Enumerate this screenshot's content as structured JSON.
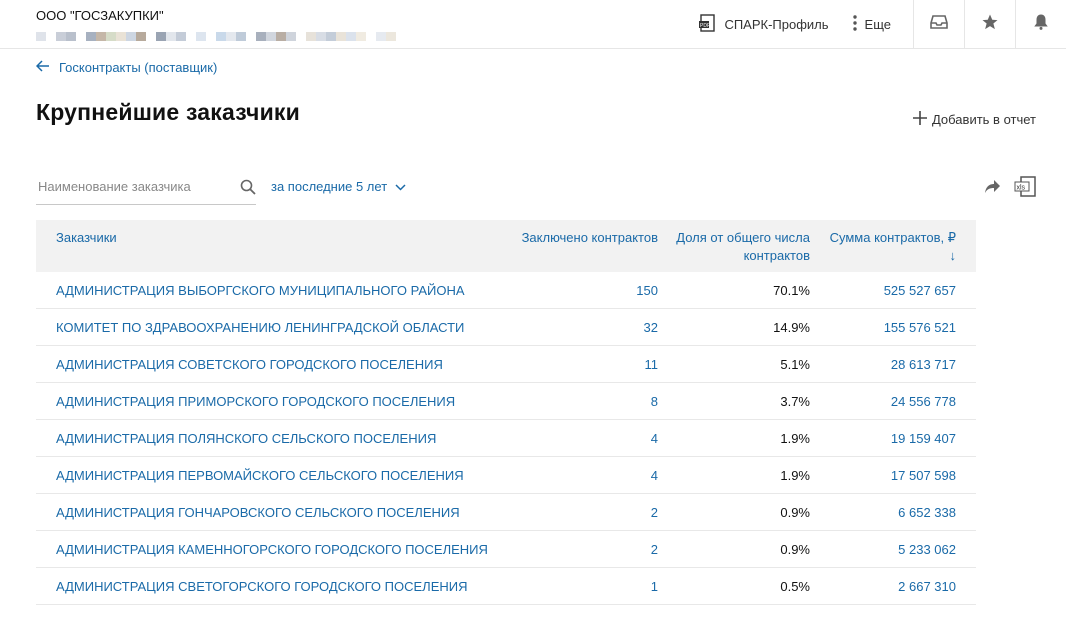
{
  "header": {
    "company": "ООО \"ГОСЗАКУПКИ\"",
    "spark_label": "СПАРК-Профиль",
    "more_label": "Еще"
  },
  "breadcrumb": {
    "back_label": "Госконтракты (поставщик)"
  },
  "page": {
    "title": "Крупнейшие заказчики",
    "add_to_report": "Добавить в отчет"
  },
  "filters": {
    "search_placeholder": "Наименование заказчика",
    "period_label": "за последние 5 лет"
  },
  "table": {
    "columns": {
      "customer": "Заказчики",
      "contracts": "Заключено контрактов",
      "share": "Доля от общего числа контрактов",
      "sum": "Сумма контрактов, ₽ ↓"
    },
    "rows": [
      {
        "name": "АДМИНИСТРАЦИЯ ВЫБОРГСКОГО МУНИЦИПАЛЬНОГО РАЙОНА",
        "contracts": "150",
        "share": "70.1%",
        "sum": "525 527 657"
      },
      {
        "name": "КОМИТЕТ ПО ЗДРАВООХРАНЕНИЮ ЛЕНИНГРАДСКОЙ ОБЛАСТИ",
        "contracts": "32",
        "share": "14.9%",
        "sum": "155 576 521"
      },
      {
        "name": "АДМИНИСТРАЦИЯ СОВЕТСКОГО ГОРОДСКОГО ПОСЕЛЕНИЯ",
        "contracts": "11",
        "share": "5.1%",
        "sum": "28 613 717"
      },
      {
        "name": "АДМИНИСТРАЦИЯ ПРИМОРСКОГО ГОРОДСКОГО ПОСЕЛЕНИЯ",
        "contracts": "8",
        "share": "3.7%",
        "sum": "24 556 778"
      },
      {
        "name": "АДМИНИСТРАЦИЯ ПОЛЯНСКОГО СЕЛЬСКОГО ПОСЕЛЕНИЯ",
        "contracts": "4",
        "share": "1.9%",
        "sum": "19 159 407"
      },
      {
        "name": "АДМИНИСТРАЦИЯ ПЕРВОМАЙСКОГО СЕЛЬСКОГО ПОСЕЛЕНИЯ",
        "contracts": "4",
        "share": "1.9%",
        "sum": "17 507 598"
      },
      {
        "name": "АДМИНИСТРАЦИЯ ГОНЧАРОВСКОГО СЕЛЬСКОГО ПОСЕЛЕНИЯ",
        "contracts": "2",
        "share": "0.9%",
        "sum": "6 652 338"
      },
      {
        "name": "АДМИНИСТРАЦИЯ КАМЕННОГОРСКОГО ГОРОДСКОГО ПОСЕЛЕНИЯ",
        "contracts": "2",
        "share": "0.9%",
        "sum": "5 233 062"
      },
      {
        "name": "АДМИНИСТРАЦИЯ СВЕТОГОРСКОГО ГОРОДСКОГО ПОСЕЛЕНИЯ",
        "contracts": "1",
        "share": "0.5%",
        "sum": "2 667 310"
      }
    ]
  },
  "icons": {
    "spark": "pdf-doc-icon",
    "more": "vertical-dots-icon",
    "inbox": "inbox-icon",
    "star": "star-icon",
    "bell": "bell-icon",
    "back": "arrow-left-icon",
    "add": "plus-icon",
    "search": "search-icon",
    "period": "chevron-down-icon",
    "share": "share-arrow-icon",
    "xls": "xls-export-icon"
  },
  "colors": {
    "link": "#1a6aa8",
    "header_bg": "#f2f2f2",
    "text": "#1a1a1a"
  }
}
